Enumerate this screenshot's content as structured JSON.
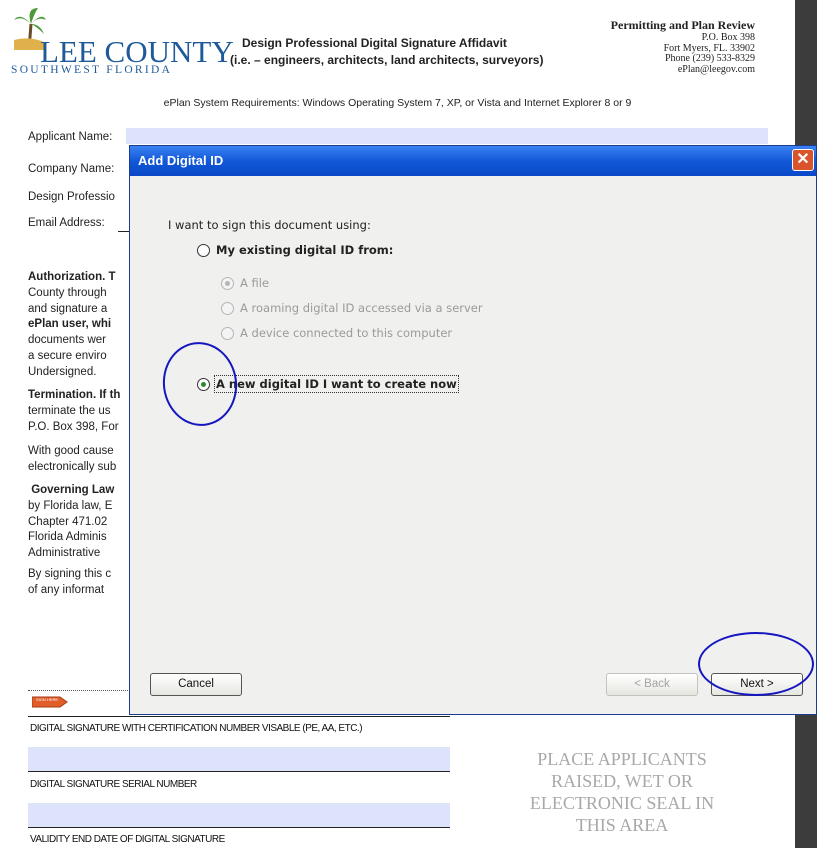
{
  "header": {
    "logo_line1": "LEE COUNTY",
    "logo_line2": "SOUTHWEST FLORIDA",
    "title": "Design Professional Digital Signature Affidavit",
    "subtitle": "(i.e. – engineers, architects, land architects, surveyors)",
    "office": {
      "title": "Permitting and Plan Review",
      "lines": [
        "P.O. Box 398",
        "Fort Myers, FL. 33902",
        "Phone (239) 533-8329",
        "ePlan@leegov.com"
      ]
    },
    "system_requirements": "ePlan System Requirements: Windows Operating System 7, XP, or Vista and Internet Explorer 8 or 9"
  },
  "form": {
    "applicant_label": "Applicant Name:",
    "company_label": "Company Name:",
    "design_professional_label": "Design Professio",
    "email_label": "Email Address:"
  },
  "document_text": {
    "authorization_lines": [
      "Authorization. T",
      "County through",
      "and signature a",
      "ePlan user, whi",
      "documents wer",
      "a secure enviro",
      "Undersigned."
    ],
    "termination_lines": [
      "Termination. If th",
      "terminate the us",
      "P.O. Box 398, For"
    ],
    "goodcause_lines": [
      "With good cause",
      "electronically sub"
    ],
    "governing_lines": [
      " Governing Law",
      "by Florida law, E",
      "Chapter 471.02",
      "Florida Adminis",
      "Administrative"
    ],
    "signing_lines": [
      "By signing this c",
      "of any informat"
    ]
  },
  "sign_here": "SIGN HERE",
  "signature_fields": {
    "digital_signature": "DIGITAL SIGNATURE WITH CERTIFICATION NUMBER VISABLE (PE, AA, ETC.)",
    "serial_number": "DIGITAL SIGNATURE SERIAL NUMBER",
    "validity_date": "VALIDITY END DATE OF DIGITAL SIGNATURE"
  },
  "seal_area": {
    "lines": [
      "PLACE APPLICANTS",
      "RAISED, WET OR",
      "ELECTRONIC SEAL IN",
      "THIS AREA"
    ]
  },
  "dialog": {
    "title": "Add Digital ID",
    "close_glyph": "✕",
    "prompt": "I want to sign this document using:",
    "option_existing": "My existing digital ID from:",
    "sub_file": "A file",
    "sub_roaming": "A roaming digital ID accessed via a server",
    "sub_device": "A device connected to this computer",
    "option_new": "A new digital ID I want to create now",
    "selected_option": "new",
    "buttons": {
      "cancel": "Cancel",
      "back": "< Back",
      "next": "Next >"
    }
  },
  "colors": {
    "field_fill": "#dde3fb",
    "title_bar": "#1258d8",
    "annotation_circle": "#1616c0"
  }
}
